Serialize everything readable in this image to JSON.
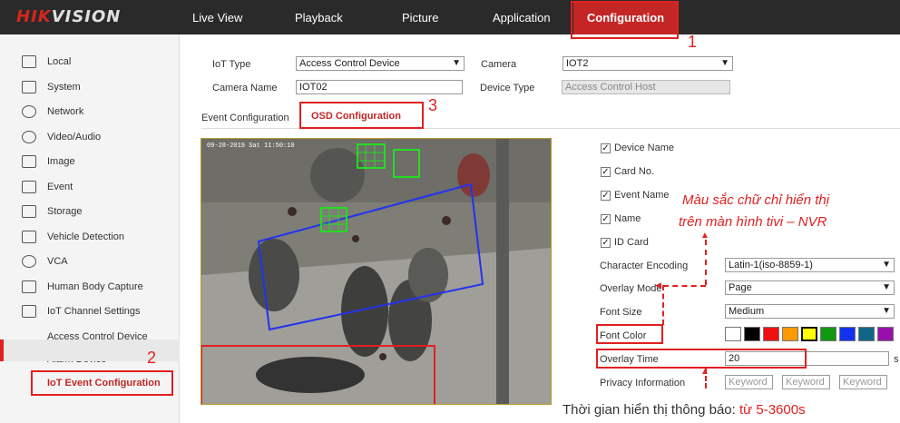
{
  "header": {
    "logo_part1": "HIK",
    "logo_part2": "VISION",
    "nav": [
      "Live View",
      "Playback",
      "Picture",
      "Application"
    ],
    "nav_active": "Configuration"
  },
  "sidebar": {
    "items": [
      {
        "label": "Local",
        "icon": "monitor-icon"
      },
      {
        "label": "System",
        "icon": "system-icon"
      },
      {
        "label": "Network",
        "icon": "globe-icon"
      },
      {
        "label": "Video/Audio",
        "icon": "video-audio-icon"
      },
      {
        "label": "Image",
        "icon": "image-icon"
      },
      {
        "label": "Event",
        "icon": "calendar-icon"
      },
      {
        "label": "Storage",
        "icon": "storage-icon"
      },
      {
        "label": "Vehicle Detection",
        "icon": "vehicle-icon"
      },
      {
        "label": "VCA",
        "icon": "vca-icon"
      },
      {
        "label": "Human Body Capture",
        "icon": "human-body-icon"
      },
      {
        "label": "IoT Channel Settings",
        "icon": "iot-icon"
      }
    ],
    "subitems": [
      "Access Control Device",
      "Alarm Device"
    ],
    "active_item": "IoT Event Configuration"
  },
  "form": {
    "iot_type_label": "IoT Type",
    "iot_type_value": "Access Control Device",
    "camera_label": "Camera",
    "camera_value": "IOT2",
    "camera_name_label": "Camera Name",
    "camera_name_value": "IOT02",
    "device_type_label": "Device Type",
    "device_type_value": "Access Control Host"
  },
  "tabs": {
    "event_config": "Event Configuration",
    "osd_config": "OSD Configuration"
  },
  "video": {
    "timestamp": "09-28-2019 Sat 11:50:10"
  },
  "osd": {
    "checkboxes": [
      "Device Name",
      "Card No.",
      "Event Name",
      "Name",
      "ID Card"
    ],
    "char_encoding_label": "Character Encoding",
    "char_encoding_value": "Latin-1(iso-8859-1)",
    "overlay_mode_label": "Overlay Mode",
    "overlay_mode_value": "Page",
    "font_size_label": "Font Size",
    "font_size_value": "Medium",
    "font_color_label": "Font Color",
    "font_colors": [
      "#ffffff",
      "#000000",
      "#ee1111",
      "#ff9900",
      "#ffff00",
      "#119911",
      "#1133ee",
      "#116688",
      "#9911aa"
    ],
    "overlay_time_label": "Overlay Time",
    "overlay_time_value": "20",
    "overlay_time_unit": "s",
    "privacy_label": "Privacy Information",
    "keyword_placeholder": "Keyword"
  },
  "annotations": {
    "step1": "1",
    "step2": "2",
    "step3": "3",
    "color_note_line1": "Màu sắc chữ chỉ hiển thị",
    "color_note_line2": "trên màn hình tivi – NVR",
    "time_note_prefix": "Thời gian hiển thị thông báo: ",
    "time_note_range": "từ 5-3600s"
  }
}
